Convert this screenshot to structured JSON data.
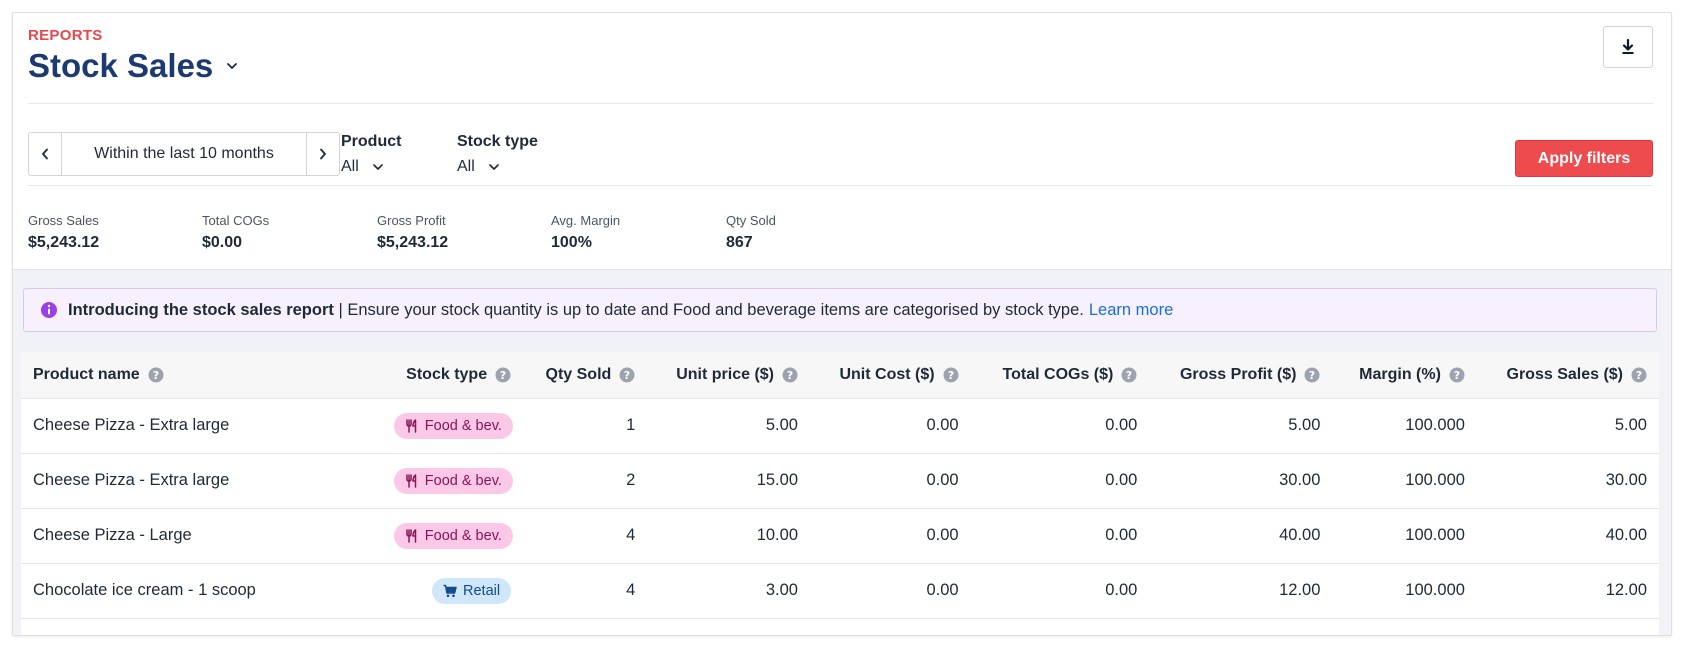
{
  "header": {
    "eyebrow": "REPORTS",
    "title": "Stock Sales"
  },
  "filters": {
    "date_range": "Within the last 10 months",
    "product": {
      "label": "Product",
      "value": "All"
    },
    "stock_type": {
      "label": "Stock type",
      "value": "All"
    },
    "apply_label": "Apply filters"
  },
  "stats": [
    {
      "label": "Gross Sales",
      "value": "$5,243.12"
    },
    {
      "label": "Total COGs",
      "value": "$0.00"
    },
    {
      "label": "Gross Profit",
      "value": "$5,243.12"
    },
    {
      "label": "Avg. Margin",
      "value": "100%"
    },
    {
      "label": "Qty Sold",
      "value": "867"
    }
  ],
  "banner": {
    "bold": "Introducing the stock sales report",
    "text": "| Ensure your stock quantity is up to date and Food and beverage items are categorised by stock type.",
    "link": "Learn more"
  },
  "table": {
    "columns": [
      "Product name",
      "Stock type",
      "Qty Sold",
      "Unit price ($)",
      "Unit Cost ($)",
      "Total COGs ($)",
      "Gross Profit ($)",
      "Margin (%)",
      "Gross Sales ($)"
    ],
    "rows": [
      {
        "product": "Cheese Pizza - Extra large",
        "stock_type": "Food & bev.",
        "qty": "1",
        "unit_price": "5.00",
        "unit_cost": "0.00",
        "total_cogs": "0.00",
        "gross_profit": "5.00",
        "margin": "100.000",
        "gross_sales": "5.00"
      },
      {
        "product": "Cheese Pizza - Extra large",
        "stock_type": "Food & bev.",
        "qty": "2",
        "unit_price": "15.00",
        "unit_cost": "0.00",
        "total_cogs": "0.00",
        "gross_profit": "30.00",
        "margin": "100.000",
        "gross_sales": "30.00"
      },
      {
        "product": "Cheese Pizza - Large",
        "stock_type": "Food & bev.",
        "qty": "4",
        "unit_price": "10.00",
        "unit_cost": "0.00",
        "total_cogs": "0.00",
        "gross_profit": "40.00",
        "margin": "100.000",
        "gross_sales": "40.00"
      },
      {
        "product": "Chocolate ice cream - 1 scoop",
        "stock_type": "Retail",
        "qty": "4",
        "unit_price": "3.00",
        "unit_cost": "0.00",
        "total_cogs": "0.00",
        "gross_profit": "12.00",
        "margin": "100.000",
        "gross_sales": "12.00"
      }
    ]
  },
  "icons": {
    "title_dropdown": "chevron-down-icon",
    "download": "download-icon",
    "prev": "chevron-left-icon",
    "next": "chevron-right-icon",
    "banner": "info-icon",
    "help": "help-circle-icon",
    "food": "utensils-icon",
    "retail": "cart-icon"
  },
  "colors": {
    "accent_red": "#ee4b4f",
    "title_navy": "#1b3a72",
    "link_blue": "#1a6fdb",
    "food_badge": "#fbc9e7",
    "retail_badge": "#cfe6fb",
    "banner_bg": "#f6f0ff"
  }
}
